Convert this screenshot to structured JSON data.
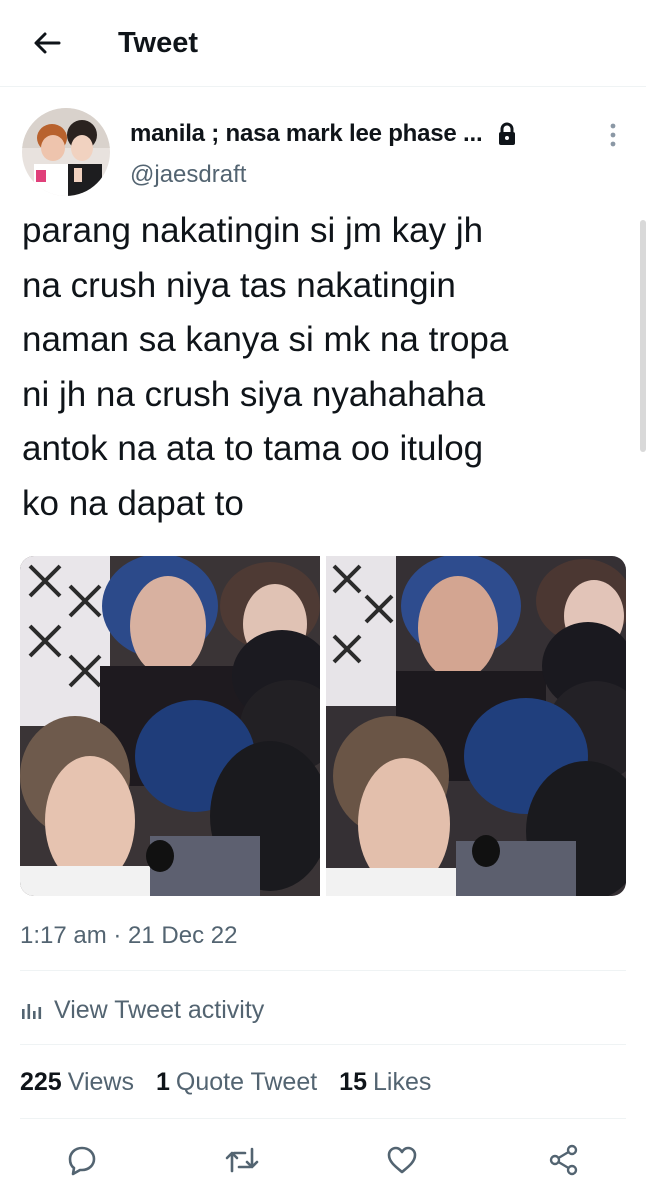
{
  "header": {
    "title": "Tweet",
    "back_icon": "arrow-left-icon"
  },
  "author": {
    "display_name": "manila ; nasa mark lee phase ...",
    "handle": "@jaesdraft",
    "protected_icon": "lock-icon",
    "more_icon": "more-vertical-icon"
  },
  "tweet": {
    "text": "parang nakatingin si jm kay jh\nna crush niya tas nakatingin\nnaman sa kanya si mk na tropa\nni jh na crush siya nyahahaha\nantok na ata to tama oo itulog\nko na dapat to",
    "timestamp": "1:17 am · 21 Dec 22"
  },
  "activity": {
    "label": "View Tweet activity",
    "icon": "bar-chart-icon"
  },
  "stats": {
    "views_count": "225",
    "views_label": "Views",
    "quotes_count": "1",
    "quotes_label": "Quote Tweet",
    "likes_count": "15",
    "likes_label": "Likes"
  },
  "actions": {
    "reply_icon": "reply-icon",
    "retweet_icon": "retweet-icon",
    "like_icon": "heart-icon",
    "share_icon": "share-icon"
  },
  "colors": {
    "text_primary": "#0f1419",
    "text_secondary": "#536471",
    "divider": "#eff3f4"
  }
}
